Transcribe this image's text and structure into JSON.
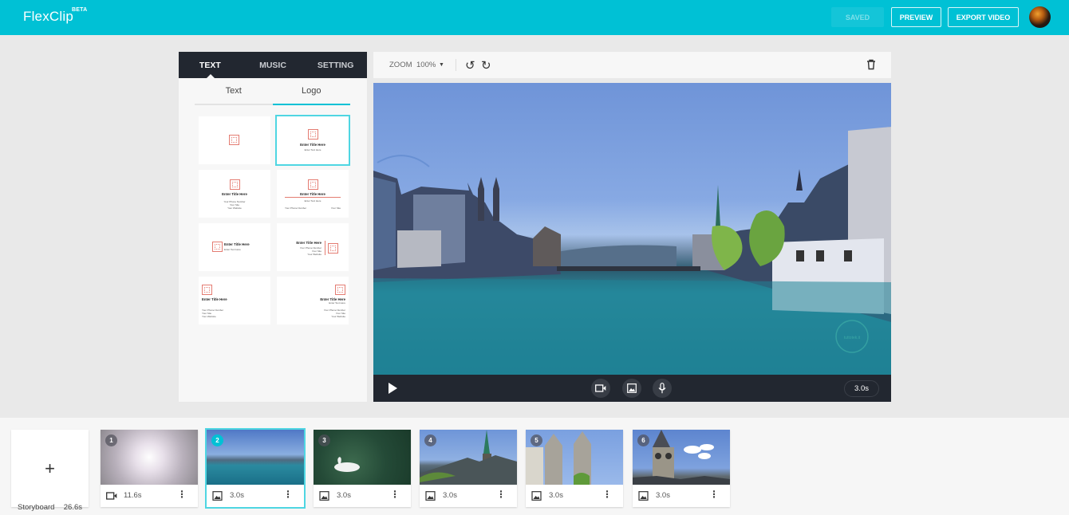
{
  "header": {
    "logo": "FlexClip",
    "logo_badge": "BETA",
    "saved_label": "SAVED",
    "preview_label": "PREVIEW",
    "export_label": "EXPORT VIDEO"
  },
  "left_panel": {
    "tabs": [
      {
        "label": "TEXT",
        "active": true
      },
      {
        "label": "MUSIC",
        "active": false
      },
      {
        "label": "SETTING",
        "active": false
      }
    ],
    "subtabs": [
      {
        "label": "Text",
        "active": false
      },
      {
        "label": "Logo",
        "active": true
      }
    ],
    "templates": [
      {
        "logo_text": "YOUR LOGO",
        "title": "",
        "subtitle": "",
        "selected": false
      },
      {
        "logo_text": "YOUR LOGO",
        "title": "Enter Title Here",
        "subtitle": "Enter Text Here",
        "selected": true
      },
      {
        "logo_text": "YOUR LOGO",
        "title": "Enter Title Here",
        "lines": [
          "Your Phone Number",
          "Your Site",
          "Your Website"
        ],
        "selected": false
      },
      {
        "logo_text": "YOUR LOGO",
        "title": "Enter Title Here",
        "subtitle": "Enter Text Here",
        "footer_left": "Your Phone Number",
        "footer_right": "Your Site",
        "selected": false
      },
      {
        "logo_text": "YOUR LOGO",
        "title": "Enter Title Here",
        "subtitle": "Enter Text Here",
        "selected": false
      },
      {
        "logo_text": "YOUR LOGO",
        "title": "Enter Title Here",
        "lines": [
          "Your Phone Number",
          "Your Site",
          "Your Website"
        ],
        "selected": false
      },
      {
        "logo_text": "YOUR LOGO",
        "title": "Enter Title Here",
        "lines": [
          "Your Phone Number",
          "Your Site",
          "Your Website"
        ],
        "selected": false
      },
      {
        "logo_text": "YOUR LOGO",
        "title": "Enter Title Here",
        "subtitle": "Enter Text Here",
        "lines": [
          "Your Phone Number",
          "Your Site",
          "Your Website"
        ],
        "selected": false
      }
    ]
  },
  "toolbar": {
    "zoom_label": "ZOOM",
    "zoom_value": "100%"
  },
  "preview": {
    "scene": "Zurich Limmat river with city buildings and church towers",
    "watermark": "tuttotek.it",
    "duration": "3.0s"
  },
  "storyboard": {
    "label": "Storyboard",
    "total_duration": "26.6s",
    "clips": [
      {
        "number": "1",
        "type": "video",
        "duration": "11.6s",
        "selected": false
      },
      {
        "number": "2",
        "type": "image",
        "duration": "3.0s",
        "selected": true
      },
      {
        "number": "3",
        "type": "image",
        "duration": "3.0s",
        "selected": false
      },
      {
        "number": "4",
        "type": "image",
        "duration": "3.0s",
        "selected": false
      },
      {
        "number": "5",
        "type": "image",
        "duration": "3.0s",
        "selected": false
      },
      {
        "number": "6",
        "type": "image",
        "duration": "3.0s",
        "selected": false
      }
    ]
  },
  "colors": {
    "brand": "#00c1d5",
    "dark_panel": "#222730",
    "logo_accent": "#e47c72"
  }
}
